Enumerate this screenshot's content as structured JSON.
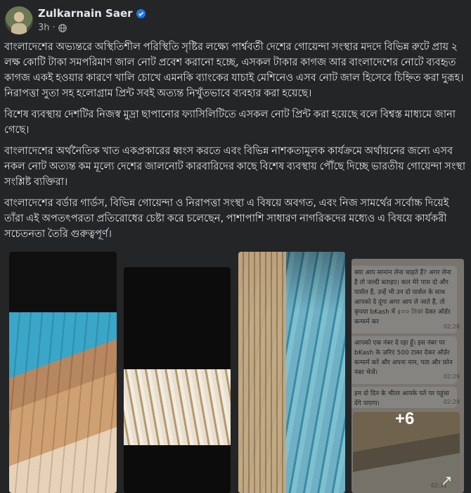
{
  "post": {
    "author": "Zulkarnain Saer",
    "time": "3h",
    "separator": "·",
    "paragraphs": [
      "বাংলাদেশের অভ্যন্তরে অস্থিতিশীল পরিস্থিতি সৃষ্টির লক্ষ্যে পার্শ্ববর্তী দেশের গোয়েন্দা সংস্থার মদদে বিভিন্ন রুটে প্রায় ২ লক্ষ কোটি টাকা সমপরিমাণ জাল নোট প্রবেশ করানো হচ্ছে, এসকল টাকার কাগজ আর বাংলাদেশের নোটে ব্যবহৃত কাগজ একই হওয়ার কারণে খালি চোখে এমনকি ব্যাংকের যাচাই মেশিনেও এসব নোট জাল হিসেবে চিহ্নিত করা দুরূহ। নিরাপত্তা সুতা সহ হলোগ্রাম প্রিন্ট সবই অত্যন্ত নিখুঁতভাবে ব্যবহার করা হয়েছে।",
      "বিশেষ ব্যবস্থায় দেশটির নিজস্ব মুদ্রা ছাপানোর ফ্যাসিলিটিতে এসকল নোট প্রিন্ট করা হয়েছে বলে বিশ্বস্ত মাধ্যমে জানা গেছে।",
      "বাংলাদেশের অর্থনৈতিক খাত একপ্রকারের ধ্বংস করতে এবং বিভিন্ন নাশকতামূলক কার্যক্রমে অর্থায়নের জন্যে এসব নকল নোট অত্যন্ত কম মূল্যে দেশের জালনোট কারবারিদের কাছে বিশেষ ব্যবস্থায় পৌঁছে দিচ্ছে ভারতীয় গোয়েন্দা সংস্থা সংশ্লিষ্ট ব্যক্তিরা।",
      "বাংলাদেশের বর্ডার গার্ডস, বিভিন্ন গোয়েন্দা ও নিরাপত্তা সংস্থা এ বিষয়ে অবগত, এবং নিজ সামর্থের সর্বোচ্চ দিয়েই তাঁরা এই অপতৎপরতা প্রতিরোধের চেষ্টা করে চলেছেন, পাশাপাশি সাধারণ নাগরিকদের মধ্যেও এ বিষয়ে কার্যকরী সচেতনতা তৈরি গুরুত্বপূর্ণ।"
    ]
  },
  "gallery": {
    "more_count": "+6",
    "chat": [
      {
        "text": "क्या आप सामान लेना चाहते हैं? अगर लेना है तो जल्दी बताइए। कल मेरे पास दो और पार्सल हैं, उन्हें भी उन दो पार्सल के साथ आपको दे दूंगा अगर आप ले जाते हैं, तो कृपया bKash में ৫০০ টাকা देकर ऑर्डर कन्फर्म कर",
        "time": "02:28"
      },
      {
        "text": "आपको एक नंबर दे रहा हूँ। इस नंबर पर bKash के ज़रिए 500 टाका देकर ऑर्डर कन्फर्म करें और अपना नाम, पता और फ़ोन नंबर भेजें।",
        "time": "02:29"
      },
      {
        "text": "हम दो दिन के भीतर आपके पते पर पहुंचा देंगे पाएगा।",
        "time": "02:29"
      }
    ],
    "photo_time": "02:31"
  },
  "colors": {
    "background": "#242526",
    "text": "#e4e6eb",
    "secondary": "#b0b3b8",
    "verified": "#1877f2"
  },
  "icons": {
    "verified": "verified-badge-icon",
    "privacy": "globe-icon",
    "expand": "expand-icon"
  }
}
